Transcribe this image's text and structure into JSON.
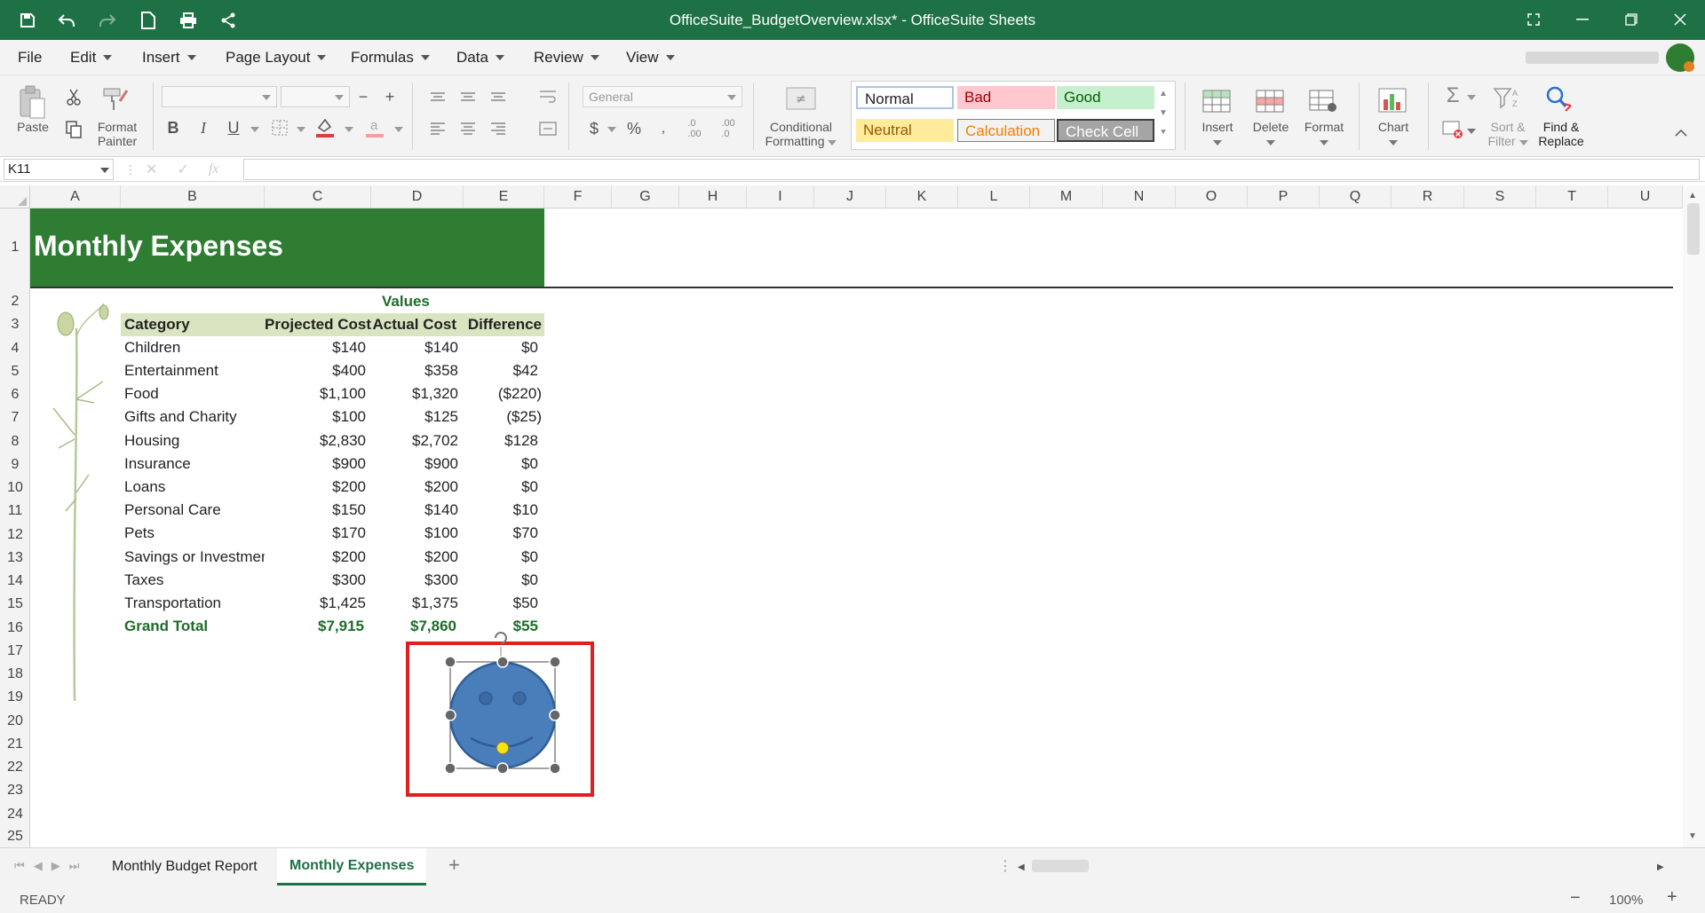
{
  "window": {
    "title": "OfficeSuite_BudgetOverview.xlsx* - OfficeSuite Sheets"
  },
  "menu": [
    "File",
    "Edit",
    "Insert",
    "Page Layout",
    "Formulas",
    "Data",
    "Review",
    "View"
  ],
  "ribbon": {
    "paste": "Paste",
    "format_painter_1": "Format",
    "format_painter_2": "Painter",
    "number_format": "General",
    "cond_fmt_1": "Conditional",
    "cond_fmt_2": "Formatting",
    "styles": {
      "normal": "Normal",
      "bad": "Bad",
      "good": "Good",
      "neutral": "Neutral",
      "calculation": "Calculation",
      "check_cell": "Check Cell"
    },
    "insert": "Insert",
    "delete": "Delete",
    "format": "Format",
    "chart": "Chart",
    "sort_1": "Sort &",
    "sort_2": "Filter",
    "find_1": "Find &",
    "find_2": "Replace",
    "bold": "B",
    "italic": "I",
    "underline": "U",
    "percent": "%"
  },
  "formula_bar": {
    "name_box": "K11",
    "fx": "fx",
    "value": ""
  },
  "columns": [
    "A",
    "B",
    "C",
    "D",
    "E",
    "F",
    "G",
    "H",
    "I",
    "J",
    "K",
    "L",
    "M",
    "N",
    "O",
    "P",
    "Q",
    "R",
    "S",
    "T",
    "U"
  ],
  "rows": [
    "1",
    "2",
    "3",
    "4",
    "5",
    "6",
    "7",
    "8",
    "9",
    "10",
    "11",
    "12",
    "13",
    "14",
    "15",
    "16",
    "17",
    "18",
    "19",
    "20",
    "21",
    "22",
    "23",
    "24",
    "25"
  ],
  "sheet": {
    "title": "Monthly Expenses",
    "values_header": "Values",
    "headers": [
      "Category",
      "Projected Cost",
      "Actual Cost",
      "Difference"
    ],
    "rows": [
      [
        "Children",
        "$140",
        "$140",
        "$0"
      ],
      [
        "Entertainment",
        "$400",
        "$358",
        "$42"
      ],
      [
        "Food",
        "$1,100",
        "$1,320",
        "($220)"
      ],
      [
        "Gifts and Charity",
        "$100",
        "$125",
        "($25)"
      ],
      [
        "Housing",
        "$2,830",
        "$2,702",
        "$128"
      ],
      [
        "Insurance",
        "$900",
        "$900",
        "$0"
      ],
      [
        "Loans",
        "$200",
        "$200",
        "$0"
      ],
      [
        "Personal Care",
        "$150",
        "$140",
        "$10"
      ],
      [
        "Pets",
        "$170",
        "$100",
        "$70"
      ],
      [
        "Savings or Investmen",
        "$200",
        "$200",
        "$0"
      ],
      [
        "Taxes",
        "$300",
        "$300",
        "$0"
      ],
      [
        "Transportation",
        "$1,425",
        "$1,375",
        "$50"
      ]
    ],
    "total": [
      "Grand Total",
      "$7,915",
      "$7,860",
      "$55"
    ]
  },
  "tabs": [
    "Monthly Budget Report",
    "Monthly Expenses"
  ],
  "active_tab": "Monthly Expenses",
  "status": {
    "ready": "READY",
    "zoom": "100%"
  },
  "colors": {
    "brand": "#1e7145",
    "title_fill": "#2e7d32",
    "header_fill": "#d9e5c1",
    "shape": "#4a7ebb",
    "highlight": "#e02020"
  }
}
